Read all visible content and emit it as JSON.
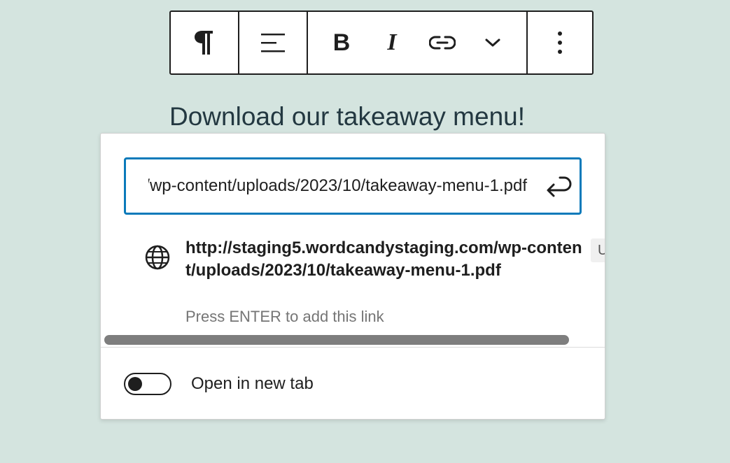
{
  "toolbar": {
    "paragraph_icon": "pilcrow-icon",
    "align_icon": "align-left-icon",
    "bold_label": "B",
    "italic_label": "I",
    "link_icon": "link-icon",
    "more_icon": "chevron-down-icon",
    "options_icon": "vertical-ellipsis-icon"
  },
  "content": {
    "heading": "Download our takeaway menu!"
  },
  "link_popover": {
    "url_value": "http://staging5.wordcandystaging.com/wp-content/uploads/2023/10/takeaway-menu-1.pdf",
    "submit_icon": "enter-return-icon",
    "suggestion": {
      "icon": "globe-icon",
      "url": "http://staging5.wordcandystaging.com/wp-content/uploads/2023/10/takeaway-menu-1.pdf",
      "hint": "Press ENTER to add this link",
      "badge": "U"
    },
    "open_new_tab_label": "Open in new tab",
    "open_new_tab_checked": false
  },
  "colors": {
    "background": "#d4e4df",
    "focus_border": "#0a7aba",
    "text": "#1e1e1e",
    "heading": "#233841",
    "hint": "#757575"
  }
}
